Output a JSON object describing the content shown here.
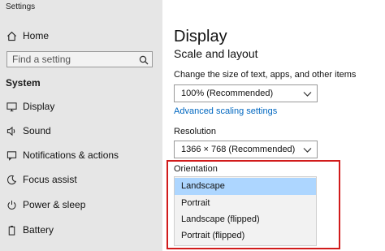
{
  "window": {
    "title": "Settings"
  },
  "sidebar": {
    "home": {
      "label": "Home",
      "icon": "home-icon"
    },
    "search": {
      "placeholder": "Find a setting",
      "icon": "search-icon"
    },
    "section_title": "System",
    "items": [
      {
        "label": "Display",
        "icon": "monitor-icon"
      },
      {
        "label": "Sound",
        "icon": "speaker-icon"
      },
      {
        "label": "Notifications & actions",
        "icon": "notifications-icon"
      },
      {
        "label": "Focus assist",
        "icon": "moon-icon"
      },
      {
        "label": "Power & sleep",
        "icon": "power-icon"
      },
      {
        "label": "Battery",
        "icon": "battery-icon"
      }
    ]
  },
  "main": {
    "page_title": "Display",
    "section_title": "Scale and layout",
    "scale": {
      "label": "Change the size of text, apps, and other items",
      "value": "100% (Recommended)"
    },
    "advanced_link": "Advanced scaling settings",
    "resolution": {
      "label": "Resolution",
      "value": "1366 × 768 (Recommended)"
    },
    "orientation": {
      "label": "Orientation",
      "options": [
        "Landscape",
        "Portrait",
        "Landscape (flipped)",
        "Portrait (flipped)"
      ],
      "selected": "Landscape"
    }
  },
  "colors": {
    "sidebar_bg": "#e6e6e6",
    "link": "#0067c0",
    "highlight_border": "#d11b1b",
    "selected_option_bg": "#add6ff"
  }
}
